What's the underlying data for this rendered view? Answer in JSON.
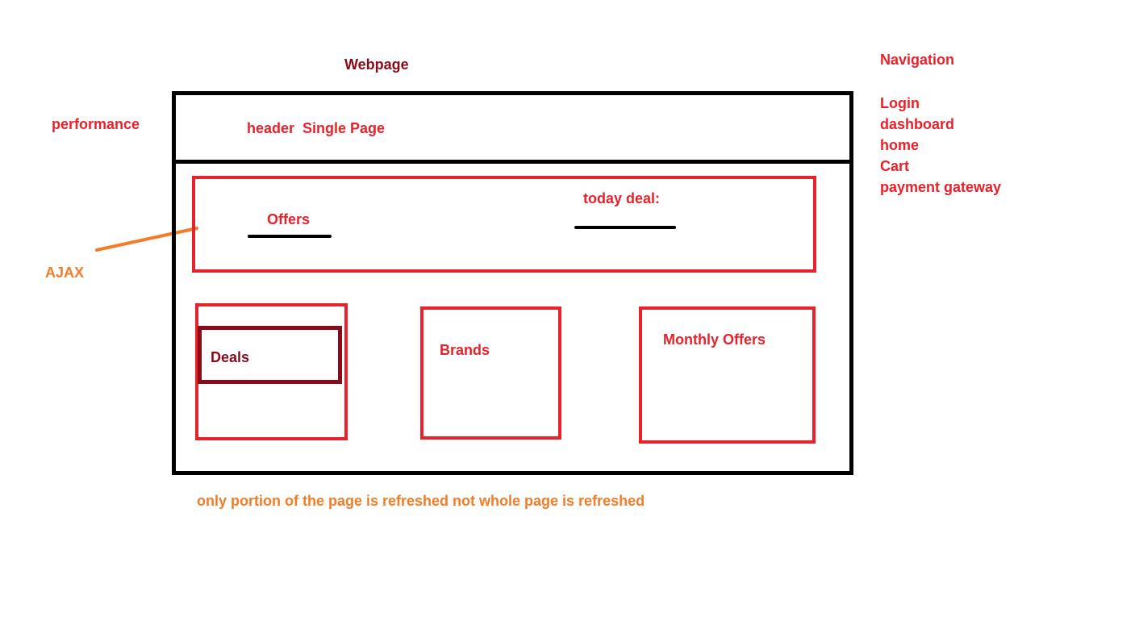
{
  "title": "Webpage",
  "side_labels": {
    "performance": "performance",
    "ajax": "AJAX"
  },
  "webpage": {
    "header": {
      "text": "header  Single Page"
    },
    "offers_panel": {
      "offers_label": "Offers",
      "today_deal_label": "today deal:"
    },
    "cards": {
      "deals": "Deals",
      "brands": "Brands",
      "monthly_offers": "Monthly Offers"
    }
  },
  "navigation": {
    "heading": "Navigation",
    "items": [
      "Login",
      "dashboard",
      "home",
      "Cart",
      "payment gateway"
    ]
  },
  "footnote": "only portion of the page is refreshed not whole page is refreshed",
  "colors": {
    "red": "#e8222a",
    "dark_red": "#8b0a1a",
    "orange": "#f47c26",
    "black": "#000000"
  }
}
